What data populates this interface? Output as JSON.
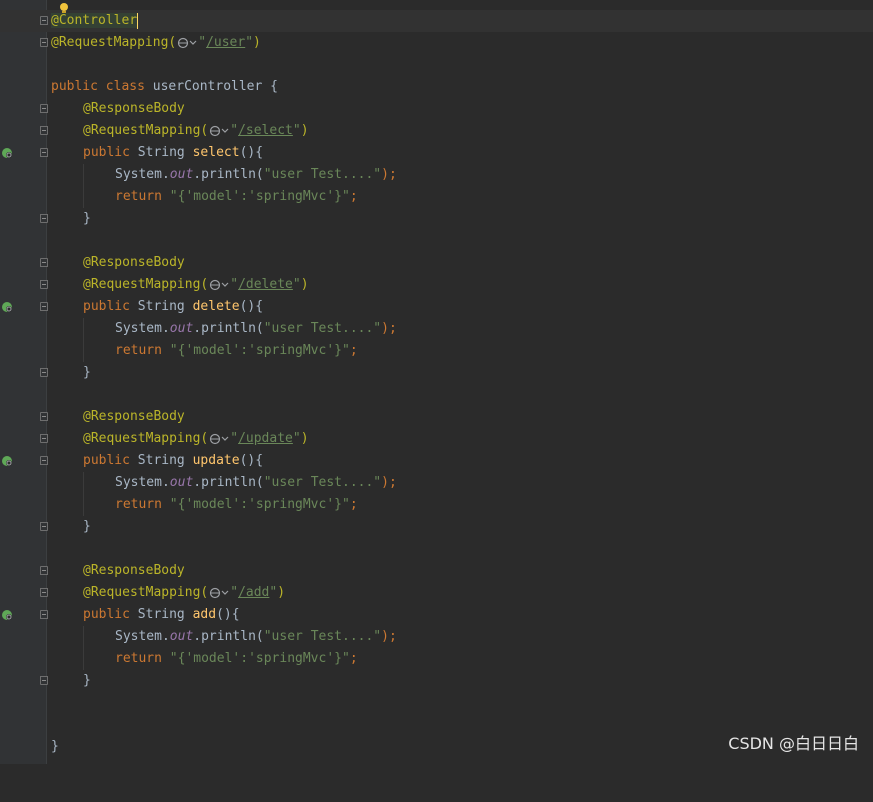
{
  "editor": {
    "lines": {
      "l1": {
        "anno": "@Controller"
      },
      "l2": {
        "anno": "@RequestMapping(",
        "q1": "\"",
        "url": "/user",
        "q2": "\"",
        "close": ")"
      },
      "l4": {
        "kw1": "public",
        "kw2": "class",
        "name": "userController {"
      },
      "select": {
        "body": "@ResponseBody",
        "map": "@RequestMapping(",
        "q1": "\"",
        "url": "/select",
        "q2": "\"",
        "close": ")",
        "kw1": "public",
        "type": "String",
        "fn": "select",
        "sig": "(){",
        "sys": "System.",
        "out": "out",
        "println": ".println(",
        "str": "\"user Test....\"",
        "end": ");",
        "ret": "return",
        "retstr": "\"{'model':'springMvc'}\"",
        "semi": ";",
        "brace": "}"
      },
      "delete": {
        "body": "@ResponseBody",
        "map": "@RequestMapping(",
        "q1": "\"",
        "url": "/delete",
        "q2": "\"",
        "close": ")",
        "kw1": "public",
        "type": "String",
        "fn": "delete",
        "sig": "(){",
        "sys": "System.",
        "out": "out",
        "println": ".println(",
        "str": "\"user Test....\"",
        "end": ");",
        "ret": "return",
        "retstr": "\"{'model':'springMvc'}\"",
        "semi": ";",
        "brace": "}"
      },
      "update": {
        "body": "@ResponseBody",
        "map": "@RequestMapping(",
        "q1": "\"",
        "url": "/update",
        "q2": "\"",
        "close": ")",
        "kw1": "public",
        "type": "String",
        "fn": "update",
        "sig": "(){",
        "sys": "System.",
        "out": "out",
        "println": ".println(",
        "str": "\"user Test....\"",
        "end": ");",
        "ret": "return",
        "retstr": "\"{'model':'springMvc'}\"",
        "semi": ";",
        "brace": "}"
      },
      "add": {
        "body": "@ResponseBody",
        "map": "@RequestMapping(",
        "q1": "\"",
        "url": "/add",
        "q2": "\"",
        "close": ")",
        "kw1": "public",
        "type": "String",
        "fn": "add",
        "sig": "(){",
        "sys": "System.",
        "out": "out",
        "println": ".println(",
        "str": "\"user Test....\"",
        "end": ");",
        "ret": "return",
        "retstr": "\"{'model':'springMvc'}\"",
        "semi": ";",
        "brace": "}"
      },
      "final": {
        "brace": "}"
      }
    }
  },
  "icons": {
    "bulb": "lightbulb-icon",
    "bean": "spring-bean-icon",
    "globe": "web-endpoint-icon"
  },
  "colors": {
    "background": "#2b2b2b",
    "keyword": "#cc7832",
    "annotation": "#bbb529",
    "string": "#6a8759",
    "method": "#ffc66d",
    "static_field": "#9876aa"
  },
  "watermark": "CSDN @白日日白"
}
